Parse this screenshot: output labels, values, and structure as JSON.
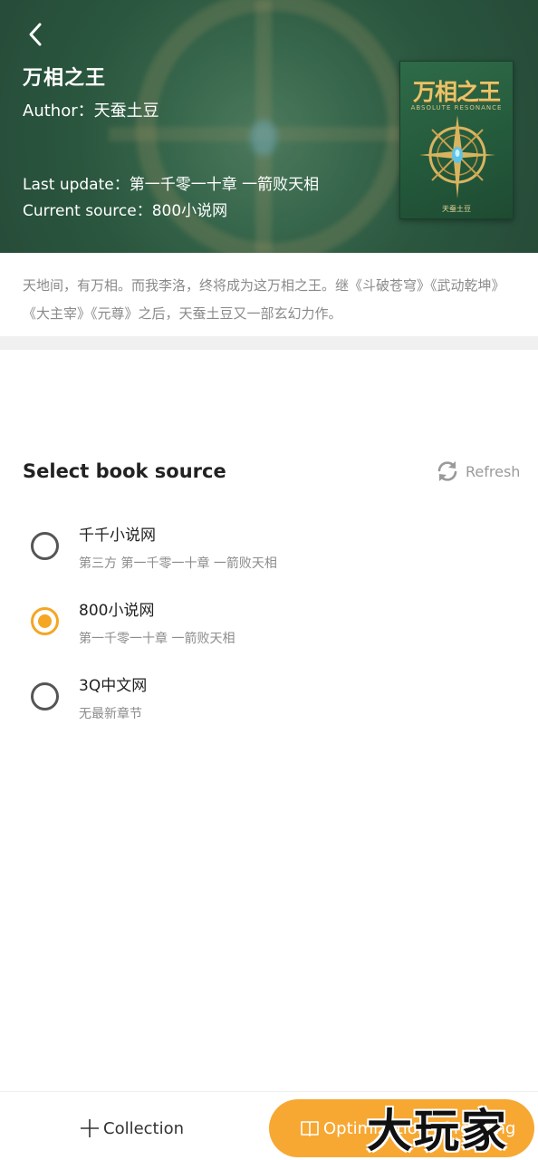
{
  "header": {
    "title": "万相之王",
    "author": "Author：天蚕土豆",
    "last_update": "Last update：第一千零一十章 一箭败天相",
    "current_source": "Current source：800小说网"
  },
  "cover": {
    "title": "万相之王",
    "subtitle": "ABSOLUTE RESONANCE",
    "author": "天蚕土豆"
  },
  "description": "天地间，有万相。而我李洛，终将成为这万相之王。继《斗破苍穹》《武动乾坤》《大主宰》《元尊》之后，天蚕土豆又一部玄幻力作。",
  "source_selection": {
    "title": "Select book source",
    "refresh_label": "Refresh",
    "options": [
      {
        "name": "千千小说网",
        "detail": "第三方 第一千零一十章 一箭败天相",
        "selected": false
      },
      {
        "name": "800小说网",
        "detail": "第一千零一十章 一箭败天相",
        "selected": true
      },
      {
        "name": "3Q中文网",
        "detail": "无最新章节",
        "selected": false
      }
    ]
  },
  "bottom_bar": {
    "collection_label": "Collection",
    "optimize_label": "Optimization of reading"
  },
  "watermark": "大玩家",
  "colors": {
    "accent": "#f5a623",
    "header_bg": "#2f5e45"
  }
}
